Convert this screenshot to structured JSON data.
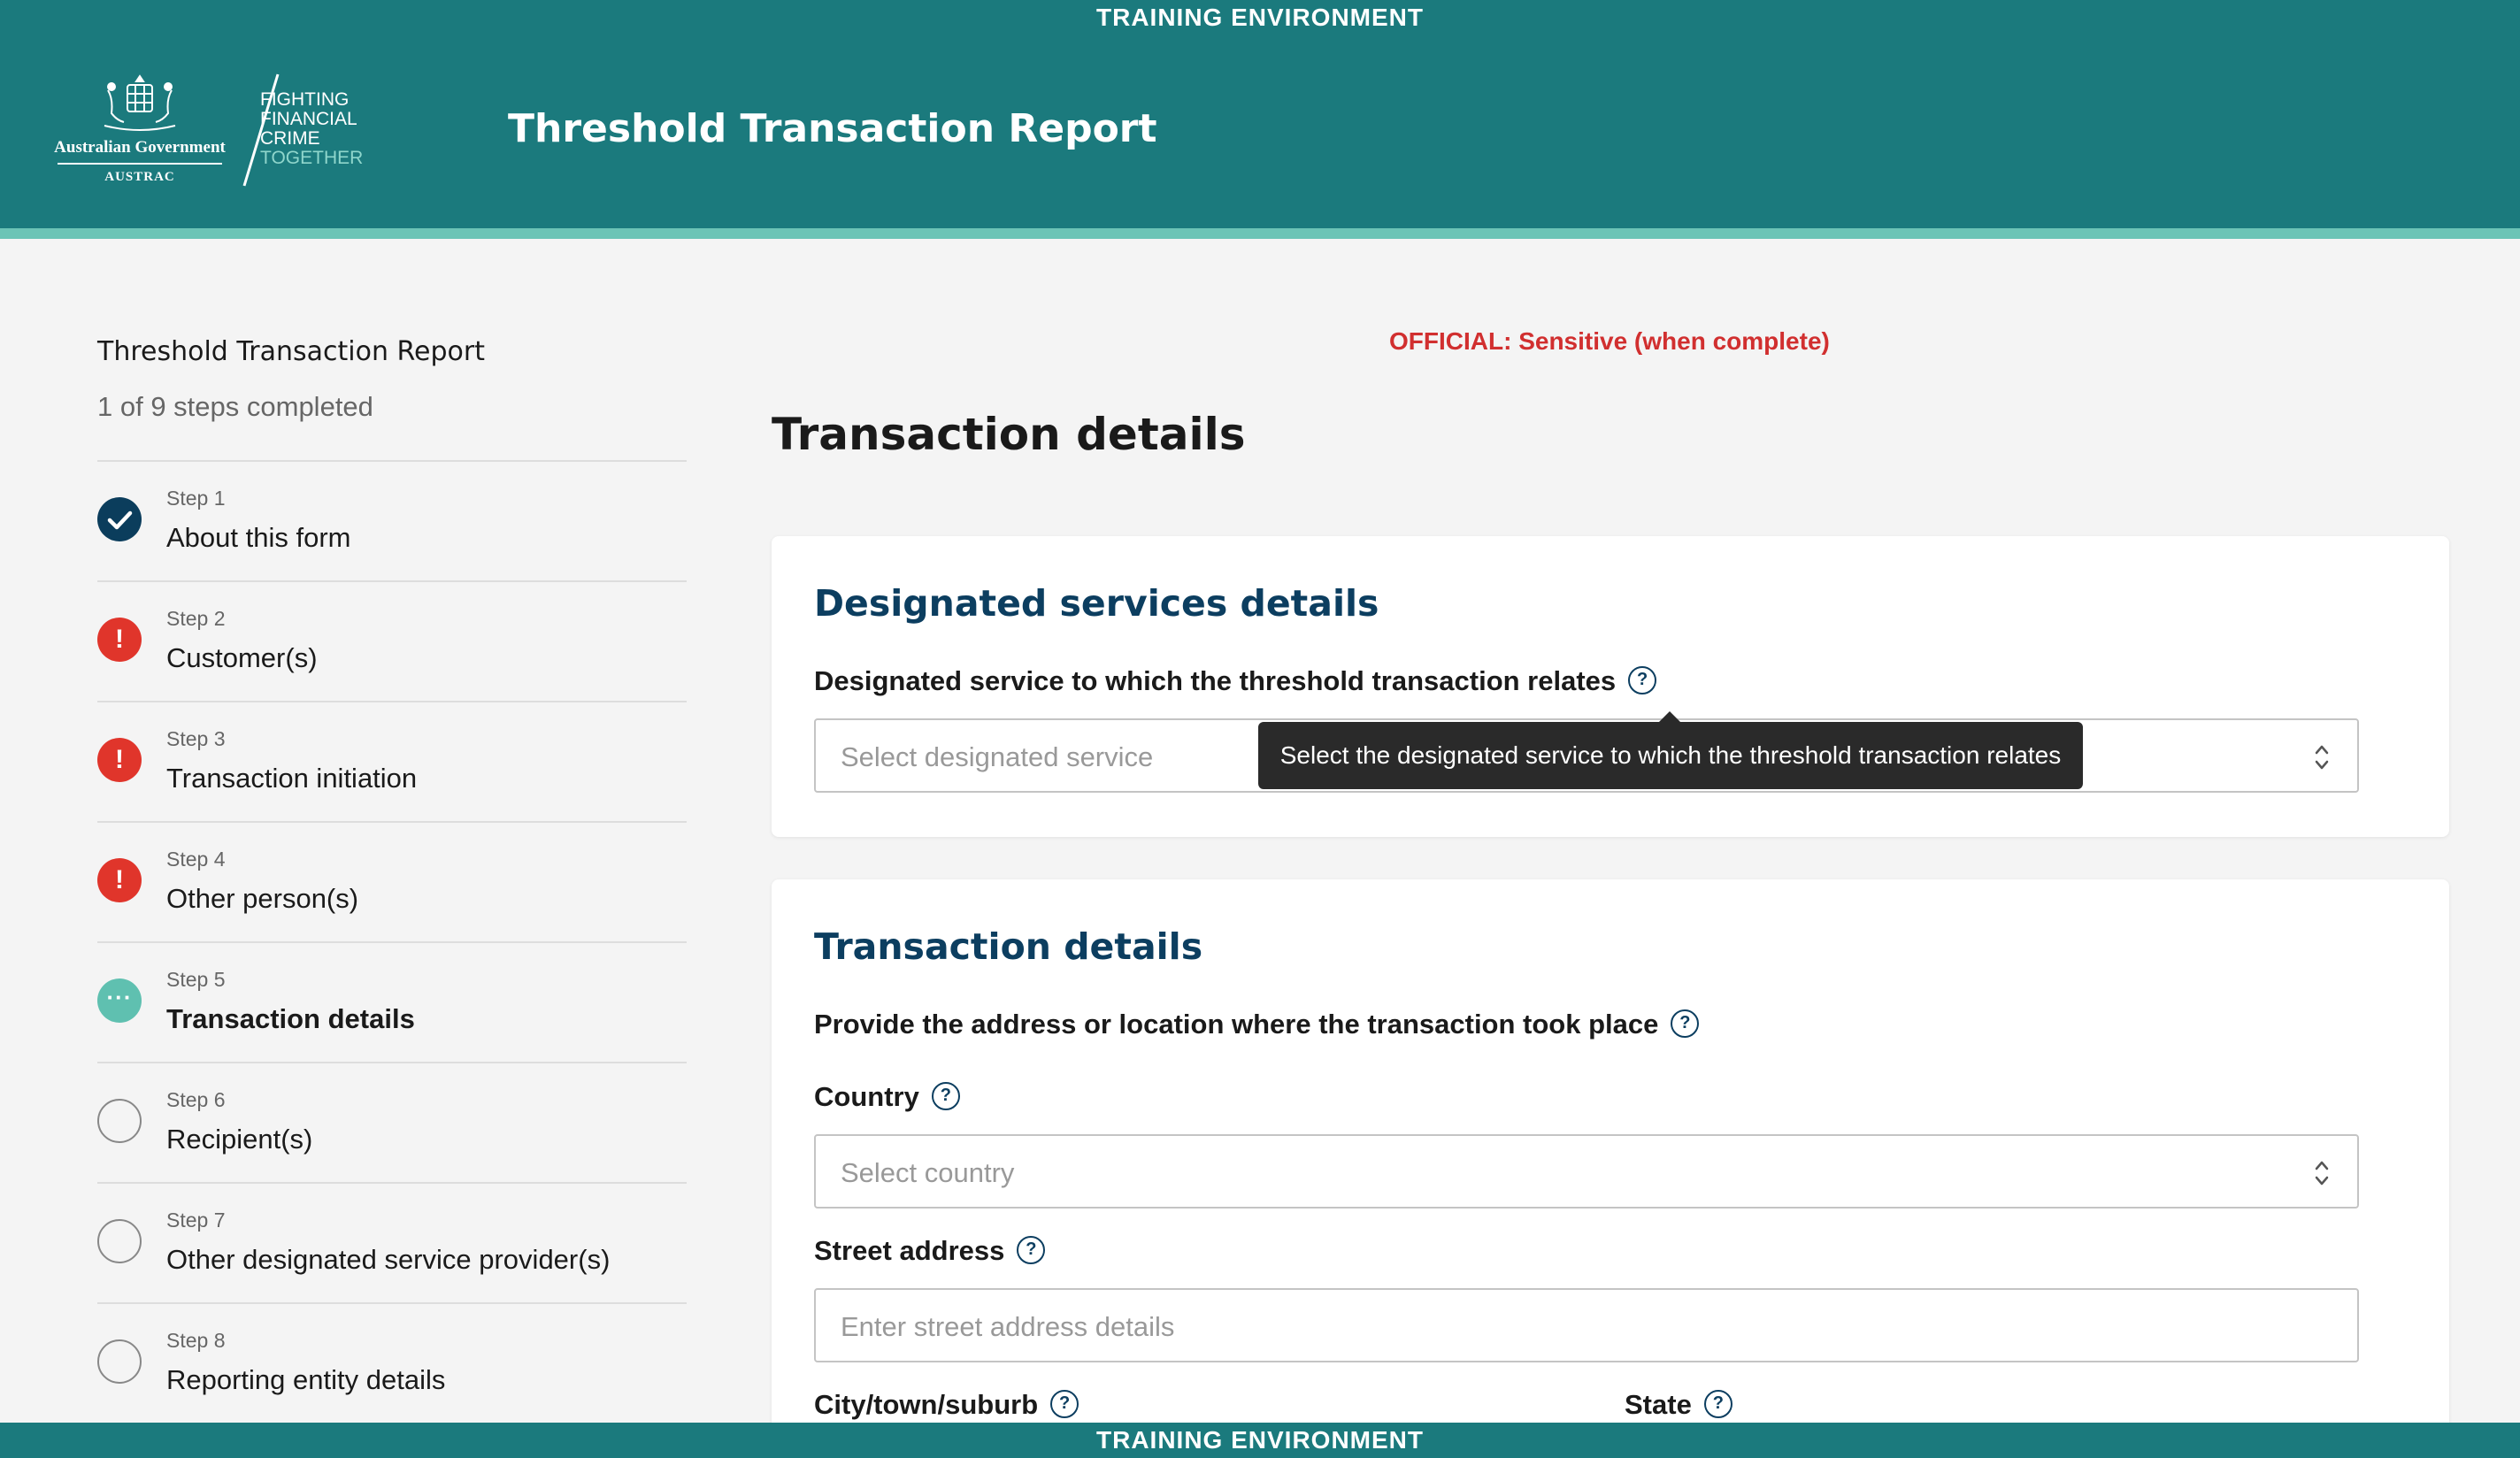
{
  "banner": {
    "training_label": "TRAINING ENVIRONMENT"
  },
  "header": {
    "gov_name": "Australian Government",
    "agency": "AUSTRAC",
    "tagline": [
      "FIGHTING",
      "FINANCIAL",
      "CRIME",
      "TOGETHER"
    ],
    "title": "Threshold Transaction Report"
  },
  "sidebar": {
    "title": "Threshold Transaction Report",
    "progress": "1 of 9 steps completed",
    "steps": [
      {
        "num": "Step 1",
        "name": "About this form",
        "status": "complete"
      },
      {
        "num": "Step 2",
        "name": "Customer(s)",
        "status": "error"
      },
      {
        "num": "Step 3",
        "name": "Transaction initiation",
        "status": "error"
      },
      {
        "num": "Step 4",
        "name": "Other person(s)",
        "status": "error"
      },
      {
        "num": "Step 5",
        "name": "Transaction details",
        "status": "in-progress"
      },
      {
        "num": "Step 6",
        "name": "Recipient(s)",
        "status": "not-started"
      },
      {
        "num": "Step 7",
        "name": "Other designated service provider(s)",
        "status": "not-started"
      },
      {
        "num": "Step 8",
        "name": "Reporting entity details",
        "status": "not-started"
      }
    ]
  },
  "main": {
    "classification": "OFFICIAL: Sensitive (when complete)",
    "page_title": "Transaction details",
    "designated": {
      "section_title": "Designated services details",
      "label": "Designated service to which the threshold transaction relates",
      "placeholder": "Select designated service",
      "tooltip": "Select the designated service to which the threshold transaction relates"
    },
    "transaction": {
      "section_title": "Transaction details",
      "location_label": "Provide the address or location where the transaction took place",
      "country_label": "Country",
      "country_placeholder": "Select country",
      "street_label": "Street address",
      "street_placeholder": "Enter street address details",
      "city_label": "City/town/suburb",
      "state_label": "State"
    }
  },
  "colors": {
    "header_bg": "#1b7a7d",
    "accent": "#6cc4b6",
    "heading": "#0c3e60",
    "error": "#e0352b",
    "complete": "#0b3d5c",
    "classification": "#d12f2f"
  }
}
